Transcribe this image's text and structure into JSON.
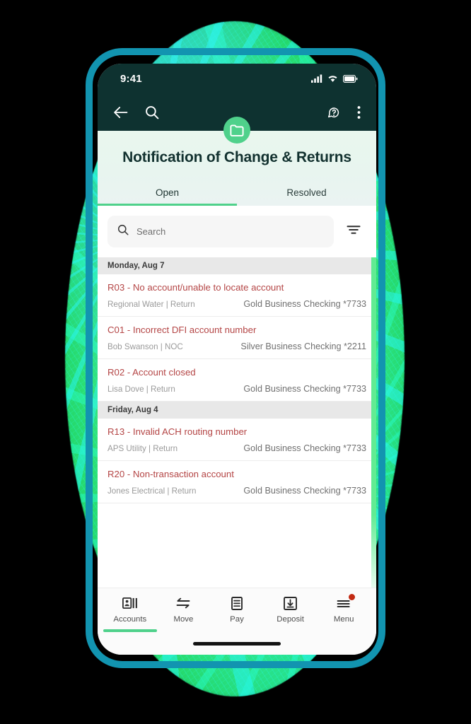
{
  "status_bar": {
    "time": "9:41",
    "icons": [
      "cellular-signal-icon",
      "wifi-icon",
      "battery-icon"
    ]
  },
  "app_bar": {
    "back_icon": "back-arrow-icon",
    "search_icon": "search-icon",
    "brand_icon": "folder-icon",
    "help_icon": "help-chat-icon",
    "overflow_icon": "more-vertical-icon",
    "background_color": "#0E3230",
    "brand_color": "#4FD18B"
  },
  "header": {
    "title": "Notification of Change & Returns",
    "tabs": [
      {
        "label": "Open",
        "active": true
      },
      {
        "label": "Resolved",
        "active": false
      }
    ]
  },
  "search": {
    "placeholder": "Search",
    "value": "",
    "icon": "search-icon",
    "filter_icon": "filter-icon"
  },
  "list": {
    "groups": [
      {
        "date": "Monday, Aug 7",
        "items": [
          {
            "title": "R03 - No account/unable to locate account",
            "party": "Regional Water |",
            "type": "Return",
            "account": "Gold Business Checking *7733"
          },
          {
            "title": "C01 - Incorrect DFI account number",
            "party": "Bob Swanson |",
            "type": "NOC",
            "account": "Silver Business Checking *2211"
          },
          {
            "title": "R02 - Account closed",
            "party": "Lisa Dove |",
            "type": "Return",
            "account": "Gold Business Checking *7733"
          }
        ]
      },
      {
        "date": "Friday, Aug 4",
        "items": [
          {
            "title": "R13 - Invalid ACH routing number",
            "party": "APS Utility |",
            "type": "Return",
            "account": "Gold Business Checking *7733"
          },
          {
            "title": "R20 - Non-transaction account",
            "party": "Jones Electrical |",
            "type": "Return",
            "account": "Gold Business Checking *7733"
          }
        ]
      }
    ],
    "scrollbar_color": "#62EB93",
    "title_color": "#B44545"
  },
  "bottom_nav": {
    "items": [
      {
        "label": "Accounts",
        "icon": "accounts-card-icon",
        "active": true,
        "badge": false
      },
      {
        "label": "Move",
        "icon": "transfer-arrows-icon",
        "active": false,
        "badge": false
      },
      {
        "label": "Pay",
        "icon": "pay-bill-icon",
        "active": false,
        "badge": false
      },
      {
        "label": "Deposit",
        "icon": "deposit-download-icon",
        "active": false,
        "badge": false
      },
      {
        "label": "Menu",
        "icon": "menu-lines-icon",
        "active": false,
        "badge": true
      }
    ],
    "badge_color": "#C22A13",
    "active_color": "#4FD18B"
  },
  "device": {
    "frame_color": "#1294B0",
    "backdrop_color": "#3EF08A"
  }
}
